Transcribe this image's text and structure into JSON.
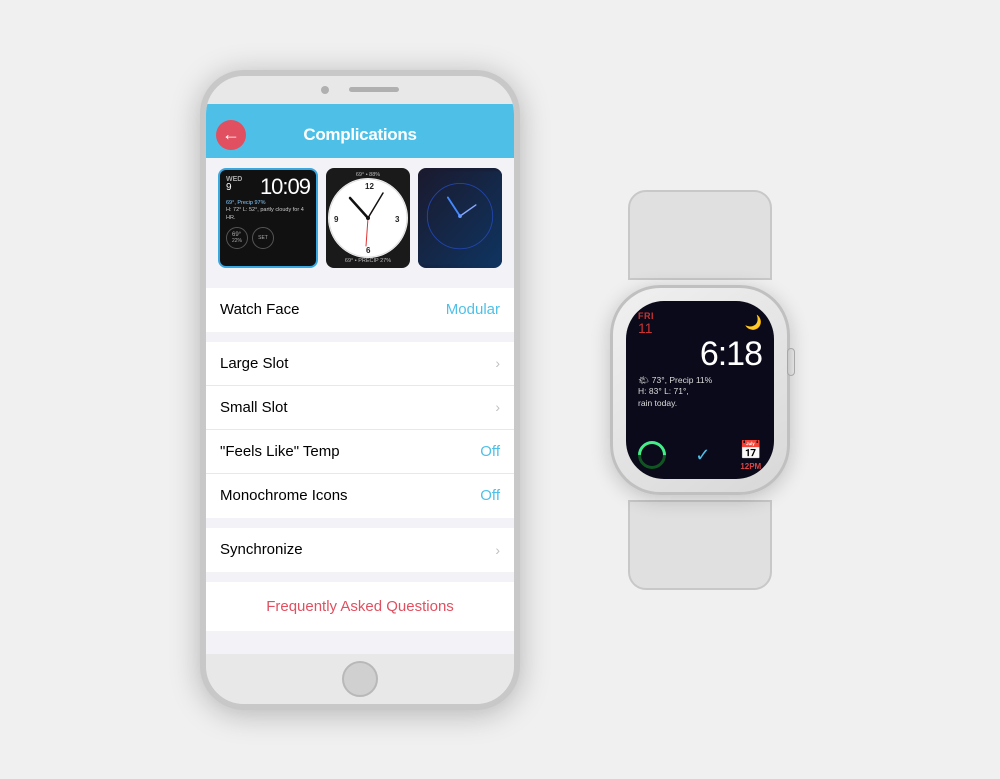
{
  "scene": {
    "background": "#f0f0f0"
  },
  "iphone": {
    "header": {
      "title": "Complications",
      "back_icon": "←"
    },
    "watch_previews": {
      "preview1": {
        "day": "WED",
        "date": "9",
        "time": "10:09",
        "weather": "69°, Precip 97%",
        "detail": "H: 72° L: 52°, partly\ncloudy for 4 HR.",
        "temp": "69°",
        "pct": "22%",
        "label": "SET"
      },
      "preview2": {
        "temp_top": "69° • 88%"
      },
      "preview3": {}
    },
    "settings": {
      "watch_face_label": "Watch Face",
      "watch_face_value": "Modular",
      "large_slot_label": "Large Slot",
      "small_slot_label": "Small Slot",
      "feels_like_label": "\"Feels Like\" Temp",
      "feels_like_value": "Off",
      "monochrome_label": "Monochrome Icons",
      "monochrome_value": "Off",
      "synchronize_label": "Synchronize"
    },
    "faq": {
      "label": "Frequently Asked Questions"
    }
  },
  "apple_watch": {
    "screen": {
      "day_label": "FRI",
      "date": "11",
      "time": "6:18",
      "moon_icon": "🌙",
      "weather_line1": "🌤 73°, Precip 11%",
      "weather_line2": "H: 83° L: 71°,",
      "weather_line3": "rain today.",
      "bottom_time": "12PM"
    }
  },
  "chevron": "›"
}
